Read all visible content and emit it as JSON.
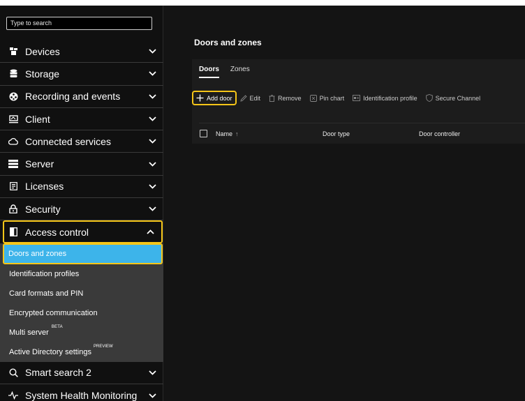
{
  "search": {
    "placeholder": "Type to search"
  },
  "sidebar": {
    "items": [
      {
        "label": "Devices",
        "icon": "devices-icon"
      },
      {
        "label": "Storage",
        "icon": "storage-icon"
      },
      {
        "label": "Recording and events",
        "icon": "recording-icon"
      },
      {
        "label": "Client",
        "icon": "client-icon"
      },
      {
        "label": "Connected services",
        "icon": "cloud-icon"
      },
      {
        "label": "Server",
        "icon": "server-icon"
      },
      {
        "label": "Licenses",
        "icon": "licenses-icon"
      },
      {
        "label": "Security",
        "icon": "lock-icon"
      },
      {
        "label": "Access control",
        "icon": "door-icon",
        "expanded": true
      }
    ],
    "subitems": [
      {
        "label": "Doors and zones",
        "selected": true
      },
      {
        "label": "Identification profiles"
      },
      {
        "label": "Card formats and PIN"
      },
      {
        "label": "Encrypted communication"
      },
      {
        "label": "Multi server",
        "badge": "BETA"
      },
      {
        "label": "Active Directory settings",
        "badge": "PREVIEW"
      }
    ],
    "after": [
      {
        "label": "Smart search 2",
        "icon": "search-icon"
      },
      {
        "label": "System Health Monitoring",
        "icon": "pulse-icon"
      }
    ]
  },
  "main": {
    "title": "Doors and zones",
    "tabs": [
      {
        "label": "Doors",
        "active": true
      },
      {
        "label": "Zones"
      }
    ],
    "toolbar": {
      "add": "Add door",
      "edit": "Edit",
      "remove": "Remove",
      "pin": "Pin chart",
      "idprofile": "Identification profile",
      "secure": "Secure Channel"
    },
    "table": {
      "columns": [
        "Name",
        "Door type",
        "Door controller"
      ],
      "sort_indicator": "↑"
    }
  },
  "colors": {
    "highlight": "#f5c518",
    "selected": "#3db4ea"
  }
}
